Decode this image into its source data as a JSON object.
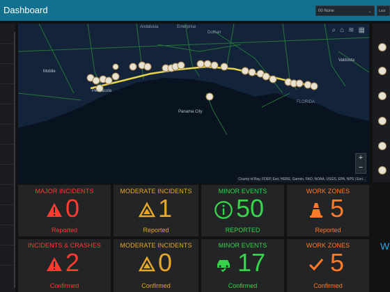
{
  "header": {
    "title": "Dashboard",
    "filter_value": "00 None",
    "last_label": "Last"
  },
  "map": {
    "attribution": "County of Bay, FDEP, Esri, HERE, Garmin, FAO, NOAA, USGS, EPA, NPS | Esri...",
    "place_labels": [
      "Andalusia",
      "Enterprise",
      "Dothan",
      "Mobile",
      "Valdosta",
      "Pensacola",
      "Panama City",
      "FLORIDA"
    ],
    "zoom_in": "+",
    "zoom_out": "−"
  },
  "stats": [
    {
      "label": "MAJOR INCIDENTS",
      "value": "0",
      "footer": "Reported",
      "color": "#ff3b30",
      "icon": "warning-icon"
    },
    {
      "label": "MODERATE INCIDENTS",
      "value": "1",
      "footer": "Reported",
      "color": "#e7a72a",
      "icon": "caution-triangle-icon"
    },
    {
      "label": "MINOR EVENTS",
      "value": "50",
      "footer": "REPORTED",
      "color": "#36d44a",
      "icon": "info-circle-icon"
    },
    {
      "label": "WORK ZONES",
      "value": "5",
      "footer": "Reported",
      "color": "#ff7a2a",
      "icon": "traffic-cone-icon"
    },
    {
      "label": "INCIDENTS & CRASHES",
      "value": "2",
      "footer": "Confirmed",
      "color": "#ff3b30",
      "icon": "warning-icon"
    },
    {
      "label": "MODERATE INCIDENTS",
      "value": "0",
      "footer": "Confirmed",
      "color": "#e7a72a",
      "icon": "caution-triangle-icon"
    },
    {
      "label": "MINOR EVENTS",
      "value": "17",
      "footer": "Confirmed",
      "color": "#36d44a",
      "icon": "car-check-icon"
    },
    {
      "label": "WORK ZONES",
      "value": "5",
      "footer": "Confirmed",
      "color": "#ff7a2a",
      "icon": "checkmark-icon"
    }
  ],
  "side_label": "W"
}
